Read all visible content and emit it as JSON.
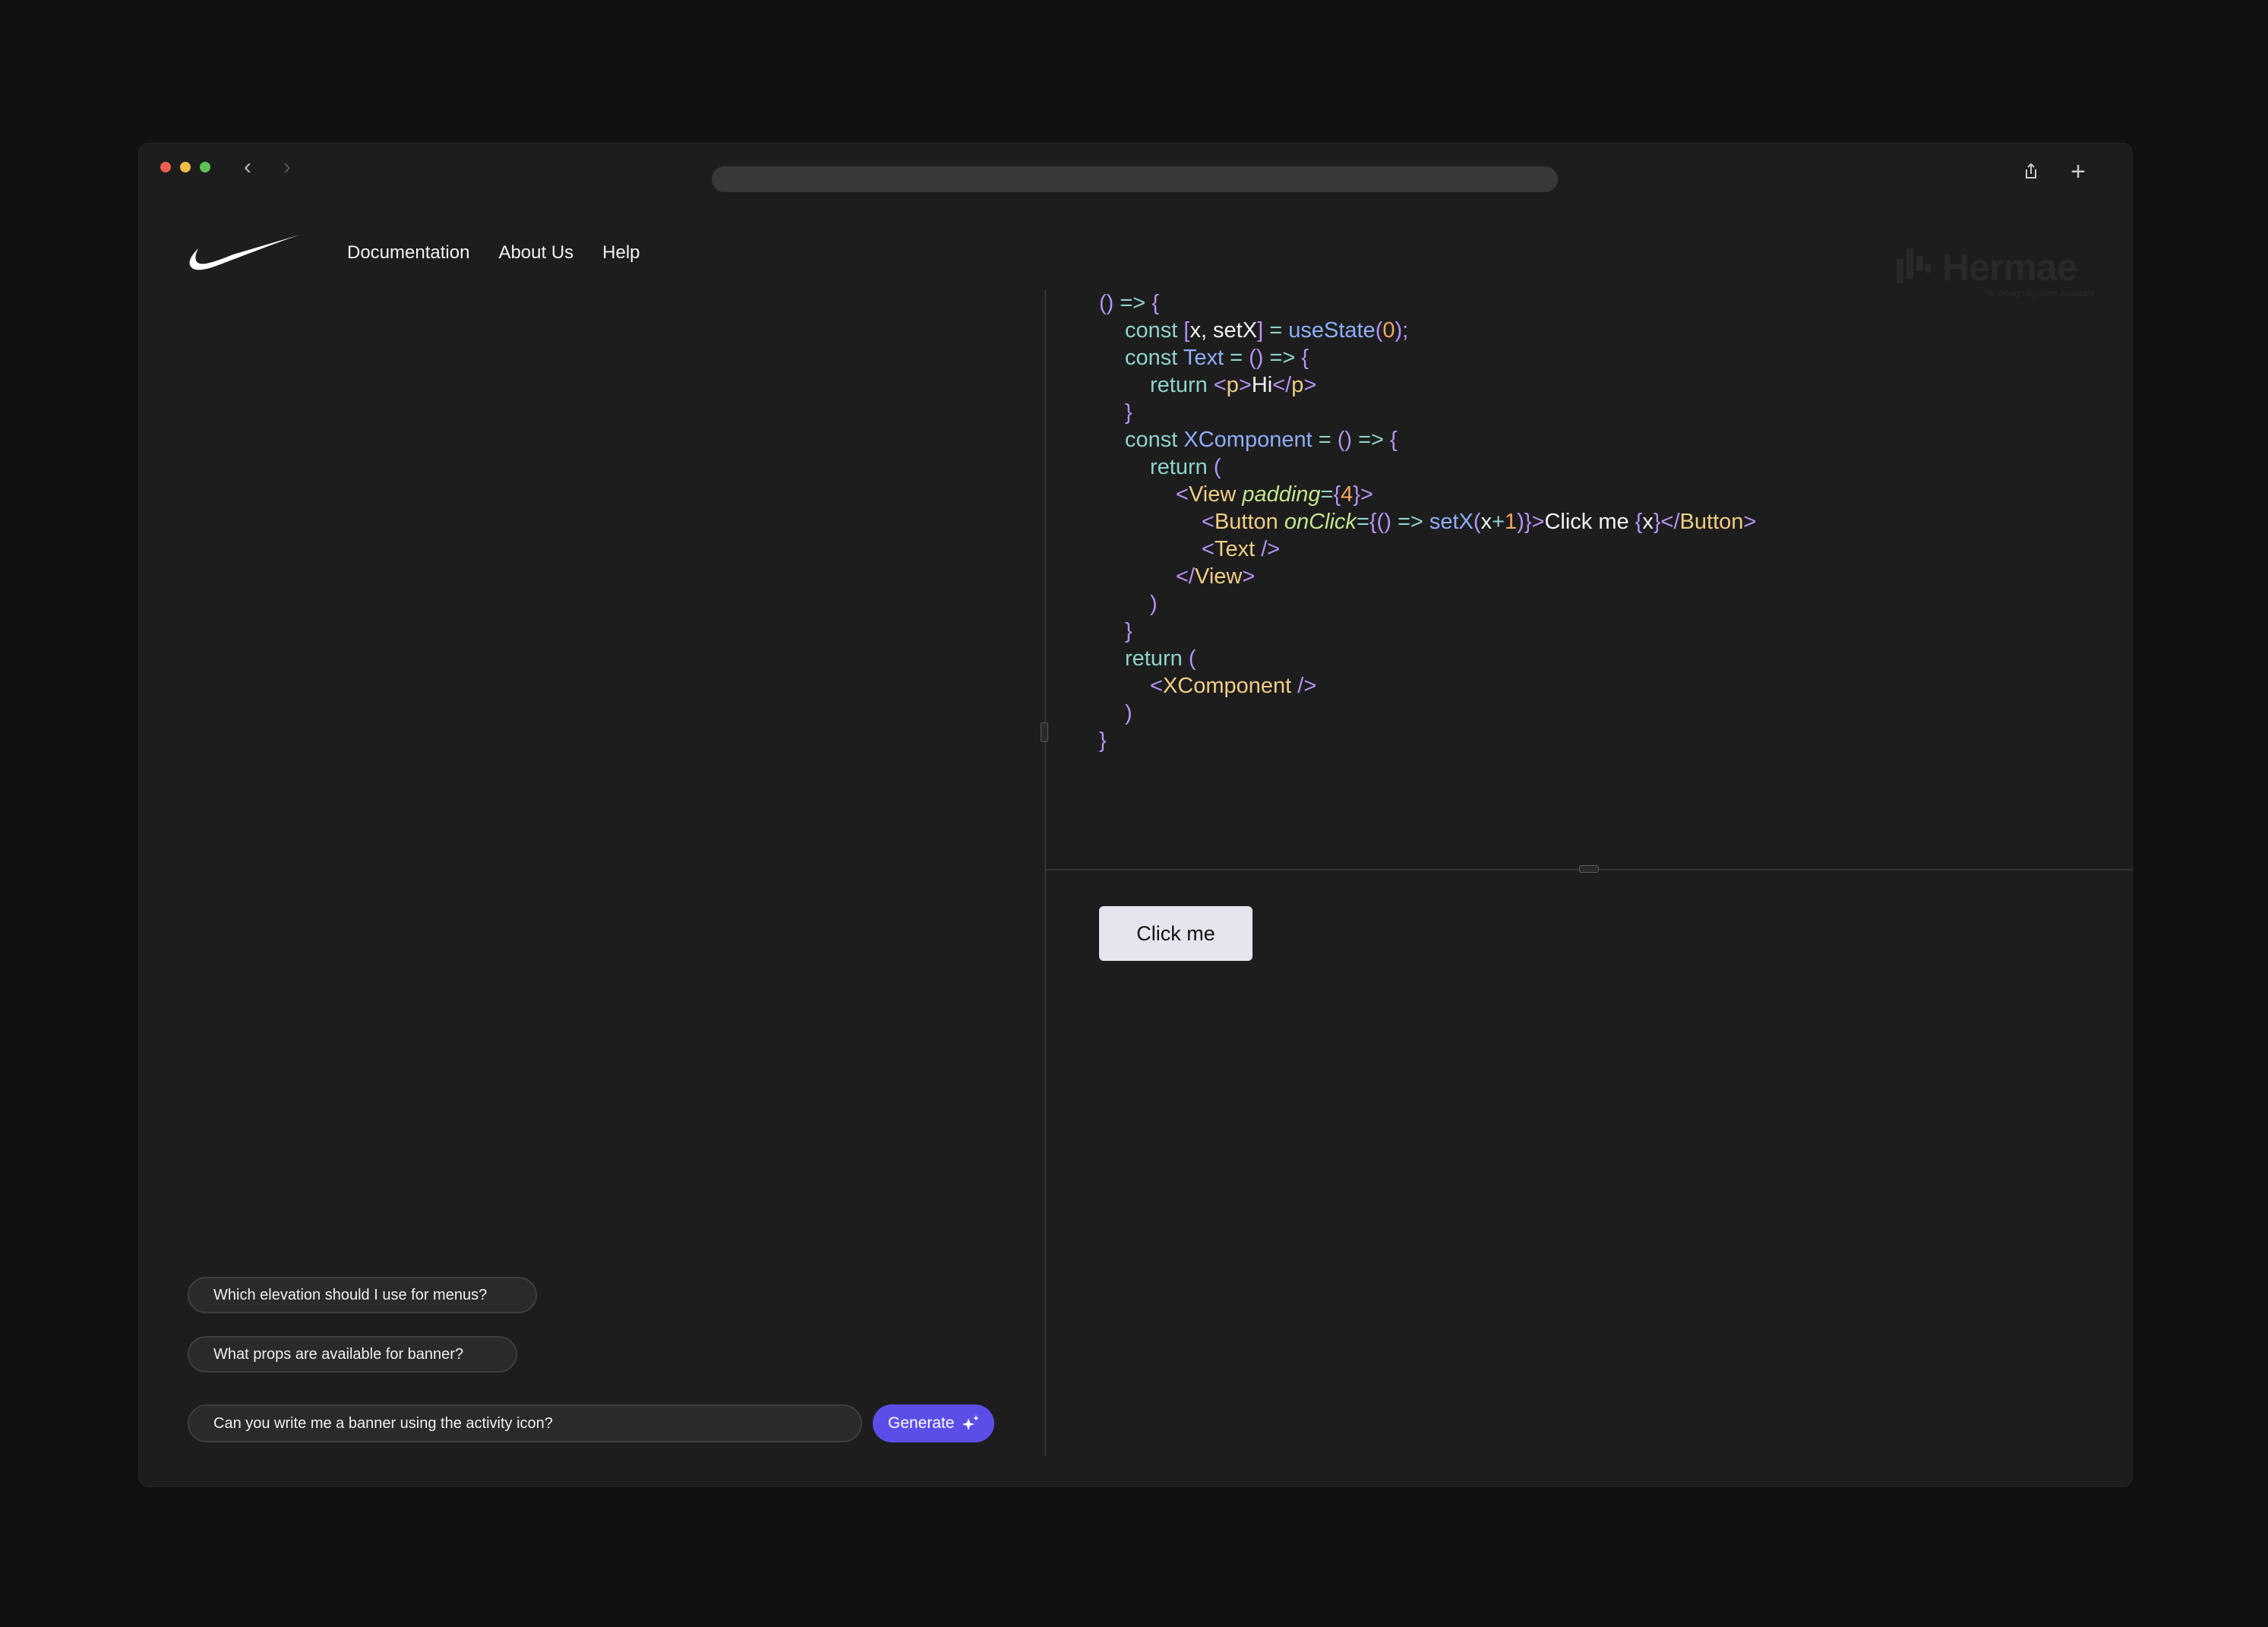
{
  "browser": {
    "back_icon": "chevron-left-icon",
    "forward_icon": "chevron-right-icon",
    "share_icon": "share-icon",
    "new_tab_icon": "plus-icon"
  },
  "header": {
    "logo": "swoosh-logo",
    "nav": [
      "Documentation",
      "About Us",
      "Help"
    ],
    "brand": {
      "name": "Hermae",
      "tagline": "AI Design Systems Assistant"
    }
  },
  "chat": {
    "suggestions": [
      "Which elevation should I use for menus?",
      "What props are available for banner?"
    ],
    "input_value": "Can you write me a banner using the activity icon?",
    "generate_label": "Generate",
    "generate_icon": "sparkle-icon"
  },
  "editor": {
    "lines": [
      [
        {
          "t": "p",
          "v": "() "
        },
        {
          "t": "kw",
          "v": "=> "
        },
        {
          "t": "p",
          "v": "{"
        }
      ],
      [
        {
          "t": "kw",
          "v": "const "
        },
        {
          "t": "p",
          "v": "["
        },
        {
          "t": "tx",
          "v": "x, setX"
        },
        {
          "t": "p",
          "v": "] "
        },
        {
          "t": "kw",
          "v": "= "
        },
        {
          "t": "fn",
          "v": "useState"
        },
        {
          "t": "p",
          "v": "("
        },
        {
          "t": "nm",
          "v": "0"
        },
        {
          "t": "p",
          "v": ");"
        }
      ],
      [
        {
          "t": "kw",
          "v": "const "
        },
        {
          "t": "fn",
          "v": "Text "
        },
        {
          "t": "kw",
          "v": "= "
        },
        {
          "t": "p",
          "v": "() "
        },
        {
          "t": "kw",
          "v": "=> "
        },
        {
          "t": "p",
          "v": "{"
        }
      ],
      [
        {
          "t": "kw",
          "v": "return "
        },
        {
          "t": "p",
          "v": "<"
        },
        {
          "t": "tg",
          "v": "p"
        },
        {
          "t": "p",
          "v": ">"
        },
        {
          "t": "tx",
          "v": "Hi"
        },
        {
          "t": "p",
          "v": "</"
        },
        {
          "t": "tg",
          "v": "p"
        },
        {
          "t": "p",
          "v": ">"
        }
      ],
      [
        {
          "t": "p",
          "v": "}"
        }
      ],
      [
        {
          "t": "kw",
          "v": "const "
        },
        {
          "t": "fn",
          "v": "XComponent "
        },
        {
          "t": "kw",
          "v": "= "
        },
        {
          "t": "p",
          "v": "() "
        },
        {
          "t": "kw",
          "v": "=> "
        },
        {
          "t": "p",
          "v": "{"
        }
      ],
      [
        {
          "t": "kw",
          "v": "return "
        },
        {
          "t": "p",
          "v": "("
        }
      ],
      [
        {
          "t": "p",
          "v": "<"
        },
        {
          "t": "tg",
          "v": "View "
        },
        {
          "t": "at",
          "v": "padding"
        },
        {
          "t": "kw",
          "v": "="
        },
        {
          "t": "p",
          "v": "{"
        },
        {
          "t": "nm",
          "v": "4"
        },
        {
          "t": "p",
          "v": "}>"
        }
      ],
      [
        {
          "t": "p",
          "v": "<"
        },
        {
          "t": "tg",
          "v": "Button "
        },
        {
          "t": "at",
          "v": "onClick"
        },
        {
          "t": "kw",
          "v": "="
        },
        {
          "t": "p",
          "v": "{() "
        },
        {
          "t": "kw",
          "v": "=> "
        },
        {
          "t": "fn",
          "v": "setX"
        },
        {
          "t": "p",
          "v": "("
        },
        {
          "t": "tx",
          "v": "x"
        },
        {
          "t": "kw",
          "v": "+"
        },
        {
          "t": "nm",
          "v": "1"
        },
        {
          "t": "p",
          "v": ")}>"
        },
        {
          "t": "tx",
          "v": "Click me "
        },
        {
          "t": "p",
          "v": "{"
        },
        {
          "t": "tx",
          "v": "x"
        },
        {
          "t": "p",
          "v": "}</"
        },
        {
          "t": "tg",
          "v": "Button"
        },
        {
          "t": "p",
          "v": ">"
        }
      ],
      [
        {
          "t": "p",
          "v": "<"
        },
        {
          "t": "tg",
          "v": "Text "
        },
        {
          "t": "p",
          "v": "/>"
        }
      ],
      [
        {
          "t": "p",
          "v": "</"
        },
        {
          "t": "tg",
          "v": "View"
        },
        {
          "t": "p",
          "v": ">"
        }
      ],
      [
        {
          "t": "p",
          "v": ")"
        }
      ],
      [
        {
          "t": "p",
          "v": "}"
        }
      ],
      [
        {
          "t": "kw",
          "v": "return "
        },
        {
          "t": "p",
          "v": "("
        }
      ],
      [
        {
          "t": "p",
          "v": "<"
        },
        {
          "t": "tg",
          "v": "XComponent "
        },
        {
          "t": "p",
          "v": "/>"
        }
      ],
      [
        {
          "t": "p",
          "v": ")"
        }
      ],
      [
        {
          "t": "p",
          "v": "}"
        }
      ]
    ]
  },
  "preview": {
    "button_label": "Click me"
  },
  "colors": {
    "accent": "#5b4ee8",
    "background": "#1d1d1d"
  }
}
